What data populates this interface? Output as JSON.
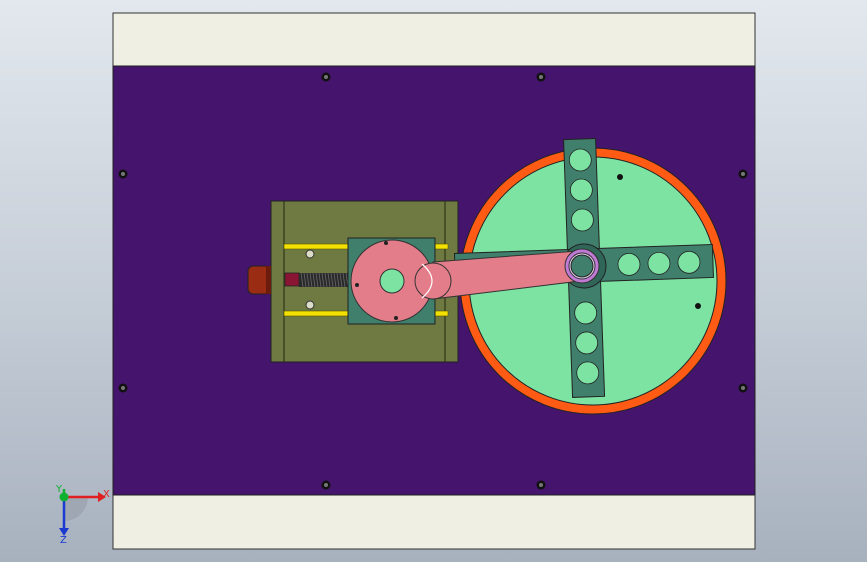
{
  "triad": {
    "x_label": "X",
    "y_label": "Y",
    "z_label": "Z",
    "colors": {
      "x": "#e02020",
      "y": "#10b030",
      "z": "#1a3ad0"
    }
  },
  "colors": {
    "base_plate": "#45146c",
    "end_strips": "#efefe3",
    "slide_body": "#6f7a43",
    "rails": "#f3e100",
    "turntable_ring": "#ff5b14",
    "turntable_disk": "#7ce3a3",
    "cross_arms": "#3f7f6c",
    "link_arm": "#e47d8a",
    "knob": "#9a2c14"
  }
}
